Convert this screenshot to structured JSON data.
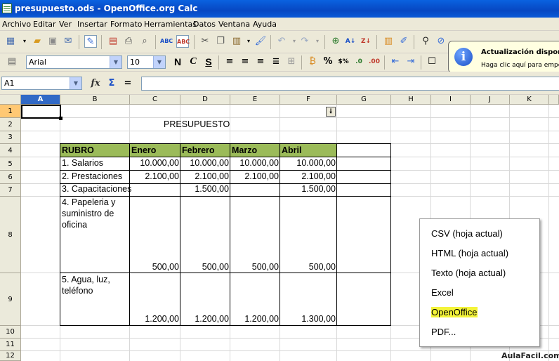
{
  "window": {
    "title": "presupuesto.ods - OpenOffice.org Calc"
  },
  "menu": [
    "Archivo",
    "Editar",
    "Ver",
    "Insertar",
    "Formato",
    "Herramientas",
    "Datos",
    "Ventana",
    "Ayuda"
  ],
  "format_bar": {
    "font_name": "Arial",
    "font_size": "10"
  },
  "formula_bar": {
    "cell_ref": "A1",
    "formula": ""
  },
  "notification": {
    "title": "Actualización disponible",
    "text": "Haga clic aquí para empezar"
  },
  "columns": [
    "A",
    "B",
    "C",
    "D",
    "E",
    "F",
    "G",
    "H",
    "I",
    "J",
    "K"
  ],
  "rows": [
    "1",
    "2",
    "3",
    "4",
    "5",
    "6",
    "7",
    "8",
    "9",
    "10",
    "11",
    "12"
  ],
  "sheet": {
    "title": "PRESUPUESTO",
    "headers": [
      "RUBRO",
      "Enero",
      "Febrero",
      "Marzo",
      "Abril"
    ],
    "rows": [
      {
        "rubro": "1. Salarios",
        "values": [
          "10.000,00",
          "10.000,00",
          "10.000,00",
          "10.000,00"
        ]
      },
      {
        "rubro": "2. Prestaciones",
        "values": [
          "2.100,00",
          "2.100,00",
          "2.100,00",
          "2.100,00"
        ]
      },
      {
        "rubro": "3. Capacitaciones",
        "values": [
          "",
          "1.500,00",
          "",
          "1.500,00"
        ]
      },
      {
        "rubro": "4. Papeleria y suministro de oficina",
        "rubro_lines": [
          "4. Papeleria y",
          "suministro de",
          "oficina"
        ],
        "values": [
          "500,00",
          "500,00",
          "500,00",
          "500,00"
        ]
      },
      {
        "rubro": "5. Agua, luz, teléfono",
        "rubro_lines": [
          "5. Agua, luz,",
          "teléfono"
        ],
        "values": [
          "1.200,00",
          "1.200,00",
          "1.200,00",
          "1.300,00"
        ]
      }
    ]
  },
  "export_menu": {
    "options": [
      "CSV (hoja actual)",
      "HTML (hoja actual)",
      "Texto (hoja actual)",
      "Excel",
      "OpenOffice",
      "PDF..."
    ],
    "highlighted": "OpenOffice",
    "highlight_color": "#f4f43a"
  },
  "colors": {
    "header_fill": "#9bbb59",
    "titlebar": "#0747c2",
    "selection": "#3169c6"
  },
  "watermark": "AulaFacil.com"
}
